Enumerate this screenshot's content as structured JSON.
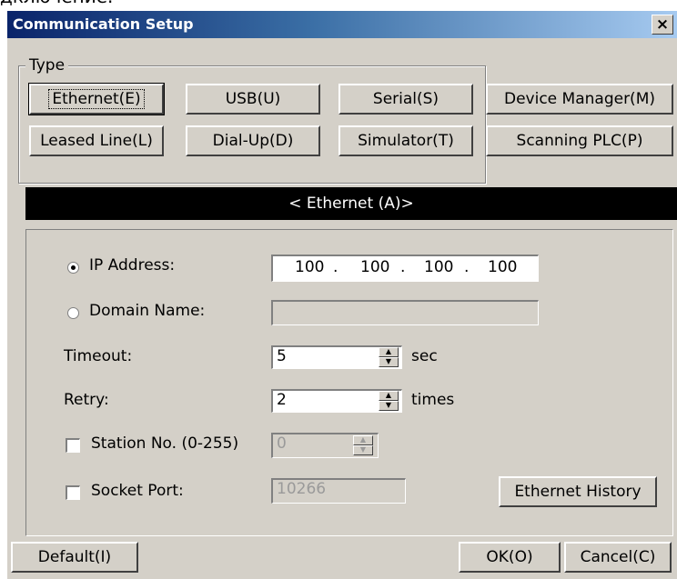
{
  "cropped_top_text": "дключение.",
  "dialog": {
    "title": "Communication Setup",
    "close_label": "×"
  },
  "type_group": {
    "label": "Type",
    "buttons": [
      "Ethernet(E)",
      "USB(U)",
      "Serial(S)",
      "Device Manager(M)",
      "Leased Line(L)",
      "Dial-Up(D)",
      "Simulator(T)",
      "Scanning PLC(P)"
    ]
  },
  "ethernet_header": "< Ethernet (A)>",
  "settings": {
    "ip_address_label": "IP Address:",
    "ip_address": [
      "100",
      "100",
      "100",
      "100"
    ],
    "ip_selected": true,
    "domain_name_label": "Domain Name:",
    "domain_name": "",
    "timeout_label": "Timeout:",
    "timeout_value": "5",
    "timeout_unit": "sec",
    "retry_label": "Retry:",
    "retry_value": "2",
    "retry_unit": "times",
    "station_label": "Station No. (0-255)",
    "station_value": "0",
    "station_checked": false,
    "socket_label": "Socket Port:",
    "socket_value": "10266",
    "socket_checked": false,
    "ethernet_history_label": "Ethernet History"
  },
  "footer": {
    "default_label": "Default(I)",
    "ok_label": "OK(O)",
    "cancel_label": "Cancel(C)"
  }
}
